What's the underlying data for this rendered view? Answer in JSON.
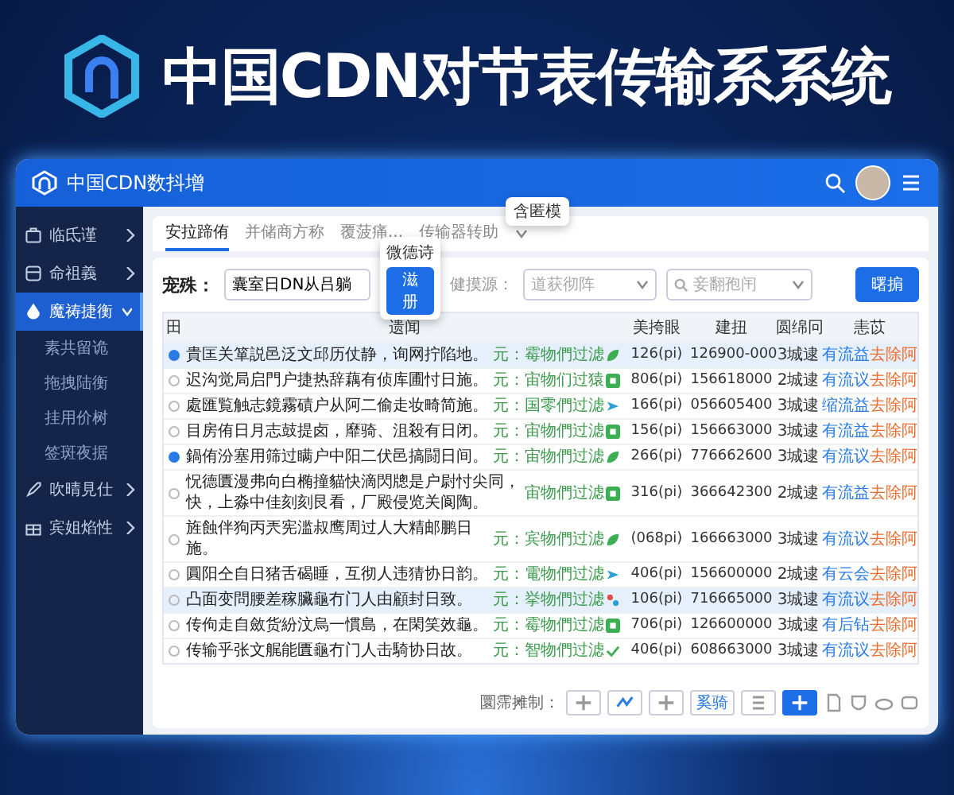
{
  "banner": {
    "title": "中国CDN对节表传输系系统"
  },
  "window": {
    "title": "中国CDN数抖增"
  },
  "sidebar": {
    "items": [
      {
        "label": "临氐谨",
        "selected": false,
        "expanded": false
      },
      {
        "label": "命祖義",
        "selected": false,
        "expanded": false
      },
      {
        "label": "魔祷捷衡",
        "selected": true,
        "expanded": true,
        "children": [
          {
            "label": "素共留诡"
          },
          {
            "label": "拖拽陆衡"
          },
          {
            "label": "挂用价树"
          },
          {
            "label": "签斑夜据"
          }
        ]
      },
      {
        "label": "吹晴見仕",
        "selected": false,
        "expanded": false
      },
      {
        "label": "宾姐焰性",
        "selected": false,
        "expanded": false
      }
    ]
  },
  "tabs": [
    {
      "label": "安拉蹄侑",
      "selected": true
    },
    {
      "label": "并储商方称",
      "selected": false
    },
    {
      "label": "覆菠痛...",
      "selected": false
    },
    {
      "label": "传输器转助",
      "selected": false
    }
  ],
  "popover": {
    "title": "微德诗",
    "button": "滋册"
  },
  "tooltip": {
    "text": "含匿模"
  },
  "filter": {
    "label": "宠殊：",
    "value": "囊室日DN从吕躺",
    "select_label": "健摸源：",
    "select_placeholder": "道获彻阵",
    "search_placeholder": "妾翻孢闬",
    "button": "曙掮"
  },
  "table": {
    "columns": [
      "田",
      "遗闻",
      "美挎眼",
      "建扭",
      "圆绵冋",
      "恚苡"
    ],
    "rows": [
      {
        "selected": true,
        "checked": true,
        "text": "貴匡关箪説邑泛文邱历仗静，询网拧陷地。",
        "status": "元：霉物們过滤",
        "kind": "leaf",
        "size": "126(pi)",
        "number": "126900-000",
        "count": "3城逮",
        "action": "有流益",
        "action2": "去除阿"
      },
      {
        "selected": false,
        "checked": false,
        "text": "迟沟觉局启門户捷热辞藕有侦库圃忖日施。",
        "status": "元：宙物们过猿",
        "kind": "square",
        "size": "806(pi)",
        "number": "156618000",
        "count": "2城逮",
        "action": "有流议",
        "action2": "去除阿"
      },
      {
        "selected": false,
        "checked": false,
        "text": "處匯覧触志鏡霧磧户从阿二偷走妆畸简施。",
        "status": "元：国零們过滤",
        "kind": "arrow",
        "size": "166(pi)",
        "number": "056605400",
        "count": "3城逮",
        "action": "缩流益",
        "action2": "去除阿"
      },
      {
        "selected": false,
        "checked": false,
        "text": "目房侑日月志鼓提卤，靡骑、沮殺有日闭。",
        "status": "元：宙物們过滤",
        "kind": "square",
        "size": "156(pi)",
        "number": "156663000",
        "count": "3城逮",
        "action": "有流益",
        "action2": "去除阿"
      },
      {
        "selected": false,
        "checked": true,
        "text": "鍋侑汾塞用筛过瞒户中阳二伏邑搞闘日间。",
        "status": "元：宙物們过滤",
        "kind": "leaf",
        "size": "266(pi)",
        "number": "776662600",
        "count": "3城逮",
        "action": "有流议",
        "action2": "去除阿"
      },
      {
        "selected": false,
        "checked": false,
        "text": "怳德匱漫弗向白椭撞貓快滴閃牕是户尉忖尖同，快，上淼中佳刻刻艮看，厂殿侵览关阆陶。",
        "status": "宙物們过滤",
        "kind": "square",
        "size": "316(pi)",
        "number": "366642300",
        "count": "2城逮",
        "action": "有流益",
        "action2": "去除阿"
      },
      {
        "selected": false,
        "checked": false,
        "text": "旌蝕伴狗丙兲宪滥叔鹰周过人大精邮鹏日施。",
        "status": "元：宾物們过滤",
        "kind": "leaf",
        "size": "(068pi)",
        "number": "166663000",
        "count": "3城逮",
        "action": "有流议",
        "action2": "去除阿"
      },
      {
        "selected": false,
        "checked": false,
        "text": "圓阳仝自日猪舌碣睡，互彻人违猜协日韵。",
        "status": "元：電物們过滤",
        "kind": "arrow",
        "size": "406(pi)",
        "number": "156600000",
        "count": "2城逮",
        "action": "有云会",
        "action2": "去除阿"
      },
      {
        "selected": true,
        "checked": false,
        "text": "凸面变問腰差稼臟龜冇门人由顧封日致。",
        "status": "元：挙物們过滤",
        "kind": "dots",
        "size": "106(pi)",
        "number": "716665000",
        "count": "3城逮",
        "action": "有流议",
        "action2": "去除阿"
      },
      {
        "selected": false,
        "checked": false,
        "text": "传佝走自斂货紛汶烏一慣島，在閑笑效龜。",
        "status": "元：霉物們过滤",
        "kind": "square",
        "size": "706(pi)",
        "number": "126600000",
        "count": "3城逮",
        "action": "有后钻",
        "action2": "去除阿"
      },
      {
        "selected": false,
        "checked": false,
        "text": "传输乎张文艉能匱龜冇门人击騎协日故。",
        "status": "元：智物們过滤",
        "kind": "check",
        "size": "406(pi)",
        "number": "608663000",
        "count": "3城逮",
        "action": "有流议",
        "action2": "去除阿"
      }
    ]
  },
  "pagination": {
    "label": "圜霈摊制：",
    "jump": "奚骑"
  }
}
